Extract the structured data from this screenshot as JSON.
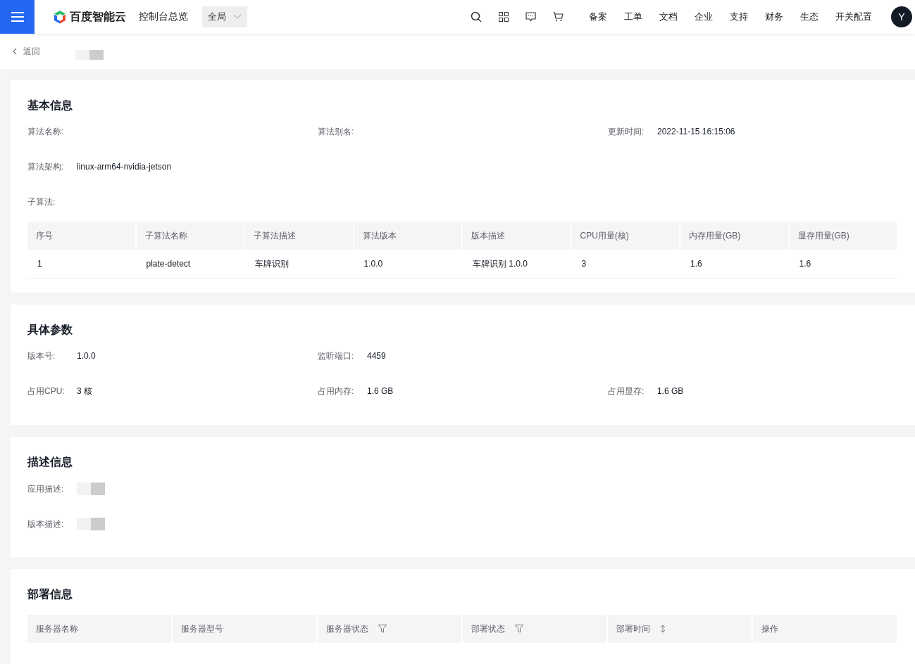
{
  "header": {
    "brand": "百度智能云",
    "console": "控制台总览",
    "region": "全局",
    "nav": [
      "备案",
      "工单",
      "文档",
      "企业",
      "支持",
      "财务",
      "生态",
      "开关配置"
    ],
    "avatar": "Y"
  },
  "back": "返回",
  "basic": {
    "title": "基本信息",
    "fields": [
      {
        "label": "算法名称:"
      },
      {
        "label": "算法别名:"
      },
      {
        "label": "更新时间:",
        "value": "2022-11-15 16:15:06"
      },
      {
        "label": "算法架构:",
        "value": "linux-arm64-nvidia-jetson"
      }
    ],
    "sub_label": "子算法:",
    "table": {
      "columns": [
        "序号",
        "子算法名称",
        "子算法描述",
        "算法版本",
        "版本描述",
        "CPU用量(核)",
        "内存用量(GB)",
        "显存用量(GB)"
      ],
      "rows": [
        [
          "1",
          "plate-detect",
          "车牌识别",
          "1.0.0",
          "车牌识别 1.0.0",
          "3",
          "1.6",
          "1.6"
        ]
      ]
    }
  },
  "params": {
    "title": "具体参数",
    "fields": [
      {
        "label": "版本号:",
        "value": "1.0.0"
      },
      {
        "label": "监听端口:",
        "value": "4459"
      },
      {
        "label": "占用CPU:",
        "value": "3 核"
      },
      {
        "label": "占用内存:",
        "value": "1.6 GB"
      },
      {
        "label": "占用显存:",
        "value": "1.6 GB"
      }
    ]
  },
  "desc": {
    "title": "描述信息",
    "fields": [
      {
        "label": "应用描述:"
      },
      {
        "label": "版本描述:"
      }
    ]
  },
  "deploy": {
    "title": "部署信息",
    "columns": [
      {
        "label": "服务器名称",
        "kind": "plain"
      },
      {
        "label": "服务器型号",
        "kind": "plain"
      },
      {
        "label": "服务器状态",
        "kind": "filter"
      },
      {
        "label": "部署状态",
        "kind": "filter"
      },
      {
        "label": "部署时间",
        "kind": "sort"
      },
      {
        "label": "操作",
        "kind": "plain"
      }
    ]
  }
}
